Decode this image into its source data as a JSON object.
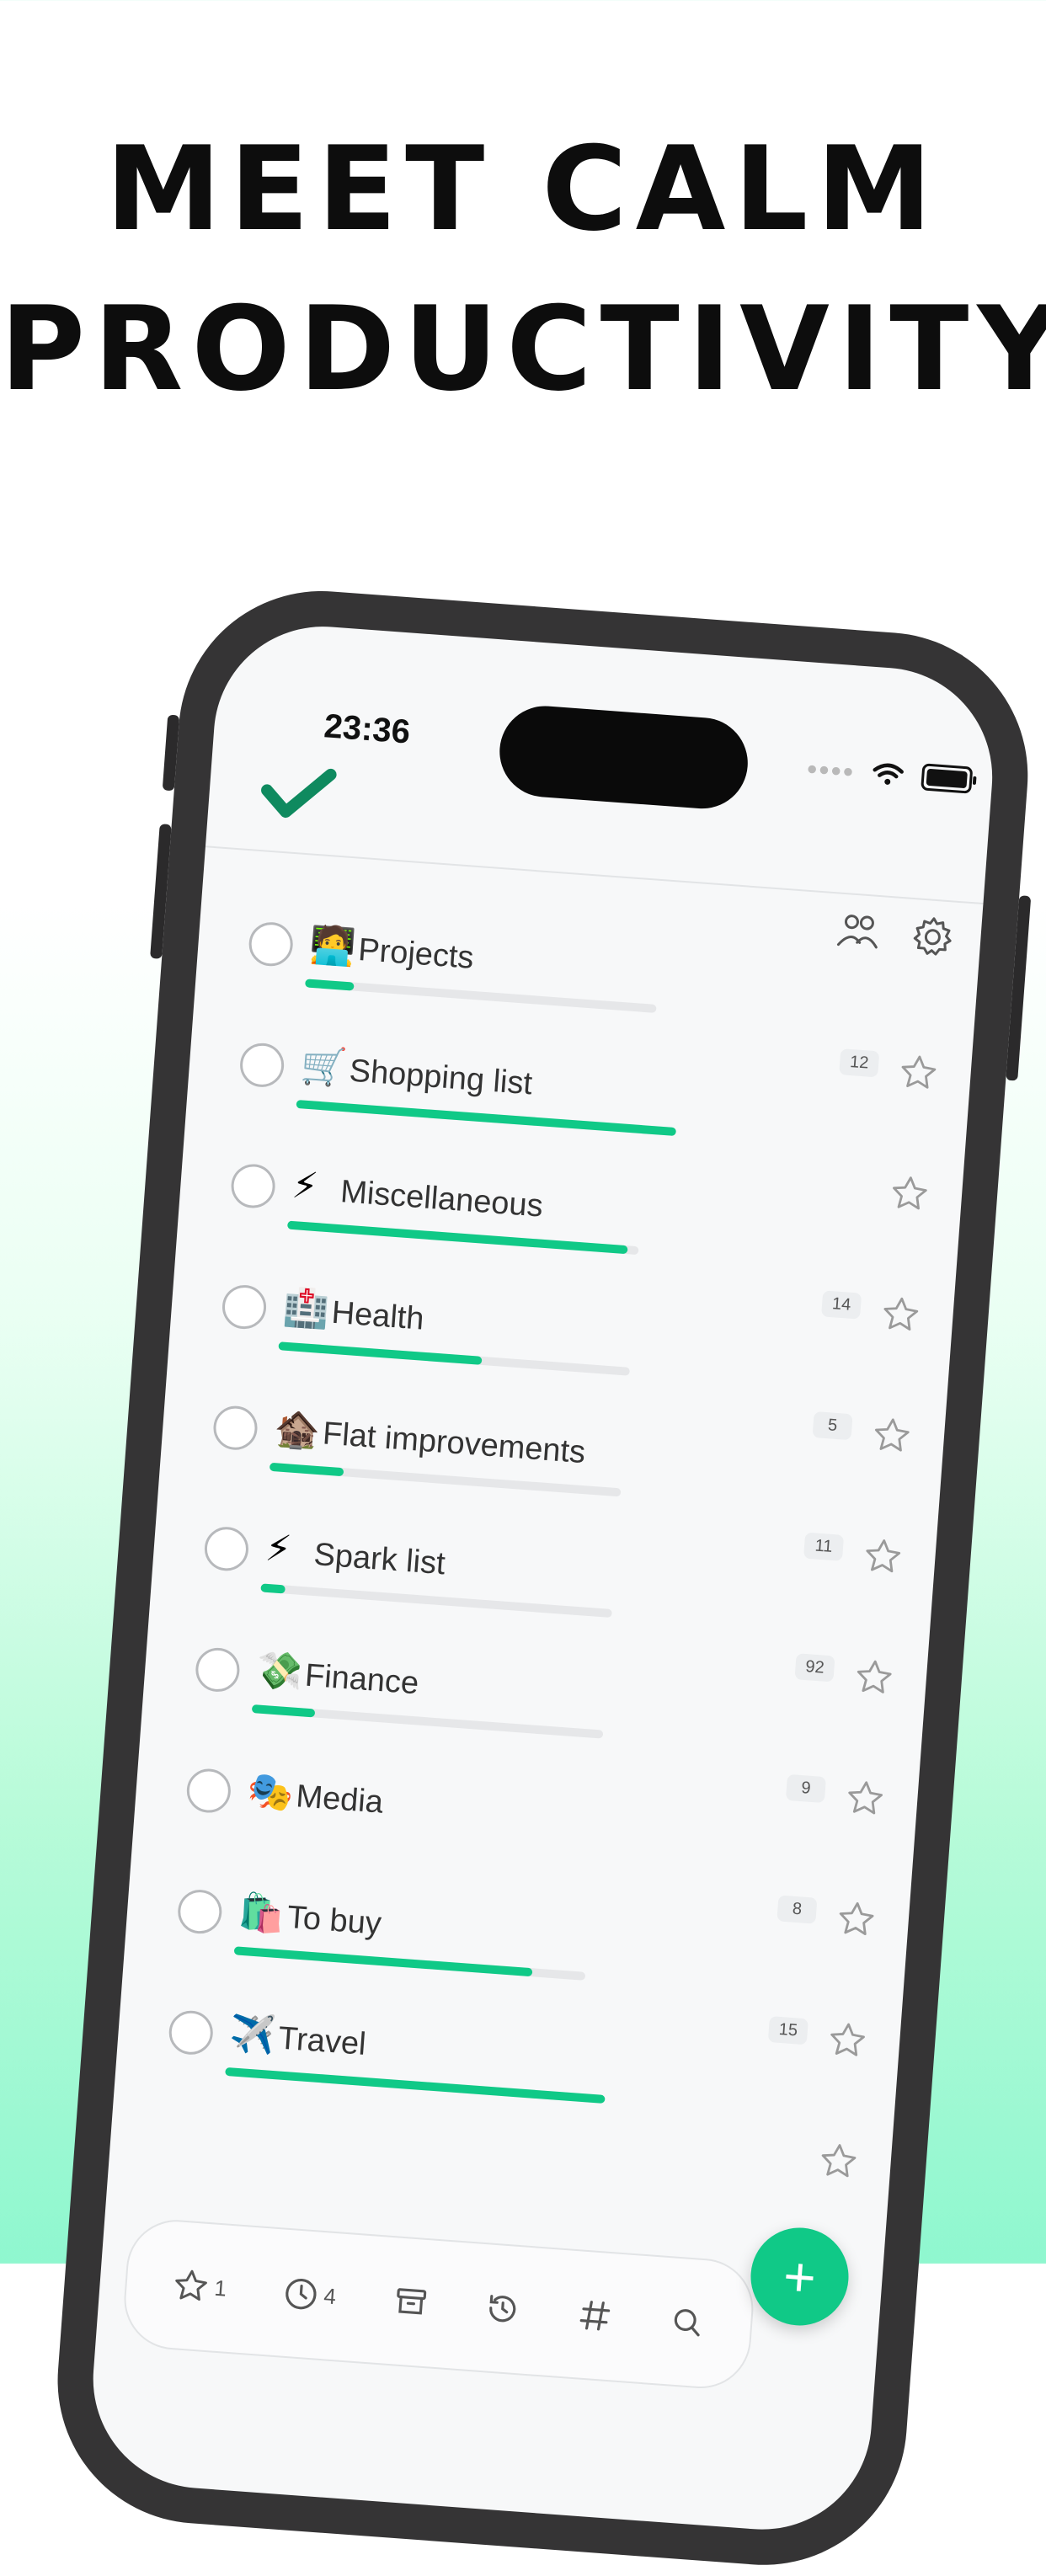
{
  "headline": {
    "line1": "Meet calm",
    "line2": "productivity"
  },
  "status_bar": {
    "time": "23:36"
  },
  "colors": {
    "accent": "#10c987",
    "text": "#333333",
    "frame": "#353435"
  },
  "lists": [
    {
      "emoji": "🧑‍💻",
      "label": "Projects",
      "progress": 0.14,
      "track_scale": 0.72,
      "count": "12"
    },
    {
      "emoji": "🛒",
      "label": "Shopping list",
      "progress": 1.0,
      "track_scale": 0.78,
      "count": ""
    },
    {
      "emoji": "⚡",
      "label": "Miscellaneous",
      "progress": 0.97,
      "track_scale": 0.72,
      "count": "14"
    },
    {
      "emoji": "🏥",
      "label": "Health",
      "progress": 0.58,
      "track_scale": 0.72,
      "count": "5"
    },
    {
      "emoji": "🏚️",
      "label": "Flat improvements",
      "progress": 0.21,
      "track_scale": 0.72,
      "count": "11"
    },
    {
      "emoji": "⚡",
      "label": "Spark list",
      "progress": 0.07,
      "track_scale": 0.72,
      "count": "92"
    },
    {
      "emoji": "💸",
      "label": "Finance",
      "progress": 0.18,
      "track_scale": 0.72,
      "count": "9"
    },
    {
      "emoji": "🎭",
      "label": "Media",
      "progress": 0.0,
      "track_scale": 0.0,
      "count": "8"
    },
    {
      "emoji": "🛍️",
      "label": "To buy",
      "progress": 0.85,
      "track_scale": 0.72,
      "count": "15"
    },
    {
      "emoji": "✈️",
      "label": "Travel",
      "progress": 1.0,
      "track_scale": 0.78,
      "count": ""
    }
  ],
  "bottom_bar": {
    "starred_count": "1",
    "scheduled_count": "4",
    "icons": [
      "star-icon",
      "clock-icon",
      "archive-icon",
      "history-icon",
      "hashtag-icon",
      "search-icon"
    ]
  },
  "fab": {
    "label": "+"
  }
}
